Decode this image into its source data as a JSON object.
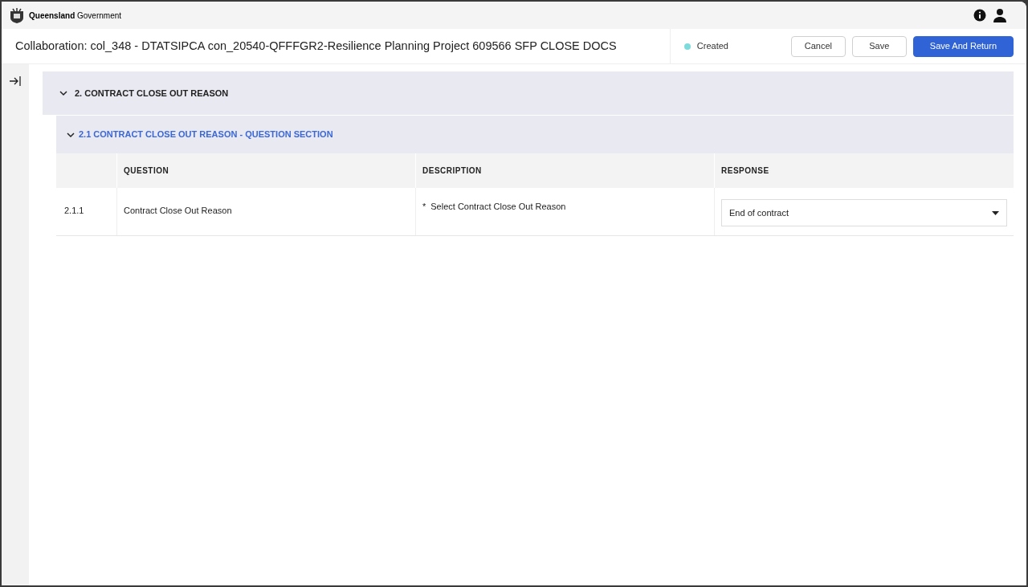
{
  "brand": {
    "logo_text": "**Queensland** Government"
  },
  "header": {
    "title": "Collaboration: col_348 - DTATSIPCA con_20540-QFFFGR2-Resilience Planning Project 609566 SFP CLOSE DOCS",
    "status": "Created",
    "buttons": [
      {
        "label": "Cancel",
        "kind": "secondary"
      },
      {
        "label": "Save",
        "kind": "secondary"
      },
      {
        "label": "Save And Return",
        "kind": "primary"
      }
    ]
  },
  "section": {
    "title": "2. CONTRACT CLOSE OUT REASON",
    "expanded": true,
    "subsection": {
      "title": "2.1 CONTRACT CLOSE OUT REASON - QUESTION SECTION",
      "expanded": true,
      "table": {
        "columns": [
          "QUESTION",
          "DESCRIPTION",
          "RESPONSE"
        ],
        "rows": [
          {
            "number": "2.1.1",
            "question": "Contract Close Out Reason",
            "required_mark": "*",
            "description": "Select Contract Close Out Reason",
            "response": "End of contract"
          }
        ]
      }
    }
  }
}
